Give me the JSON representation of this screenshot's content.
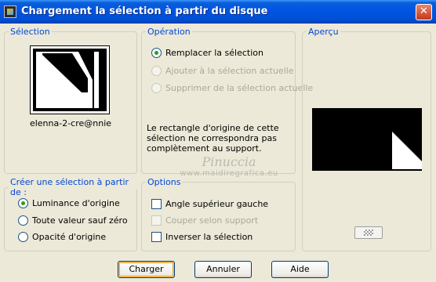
{
  "window": {
    "title": "Chargement la sélection à partir du disque",
    "close_glyph": "✕"
  },
  "selection": {
    "legend": "Sélection",
    "filename": "elenna-2-cre@nnie"
  },
  "operation": {
    "legend": "Opération",
    "options": [
      {
        "label": "Remplacer la sélection",
        "checked": true,
        "enabled": true
      },
      {
        "label": "Ajouter à la sélection actuelle",
        "checked": false,
        "enabled": false
      },
      {
        "label": "Supprimer de la sélection actuelle",
        "checked": false,
        "enabled": false
      }
    ],
    "warning": "Le rectangle d'origine de cette sélection ne correspondra pas complètement au support."
  },
  "preview": {
    "legend": "Aperçu",
    "checker_icon": "transparency-checker-icon"
  },
  "create_from": {
    "legend": "Créer une sélection à partir de :",
    "options": [
      {
        "label": "Luminance d'origine",
        "checked": true
      },
      {
        "label": "Toute valeur sauf zéro",
        "checked": false
      },
      {
        "label": "Opacité d'origine",
        "checked": false
      }
    ]
  },
  "options": {
    "legend": "Options",
    "items": [
      {
        "label": "Angle supérieur gauche",
        "checked": false,
        "enabled": true
      },
      {
        "label": "Couper selon support",
        "checked": false,
        "enabled": false
      },
      {
        "label": "Inverser la sélection",
        "checked": false,
        "enabled": true
      }
    ]
  },
  "watermark": {
    "line1": "Pinuccia",
    "line2": "www.maidiregrafica.eu"
  },
  "buttons": {
    "load": "Charger",
    "cancel": "Annuler",
    "help": "Aide"
  },
  "colors": {
    "accent": "#0046d5",
    "titlebar": "#0054e3",
    "radio_dot": "#21a121"
  }
}
